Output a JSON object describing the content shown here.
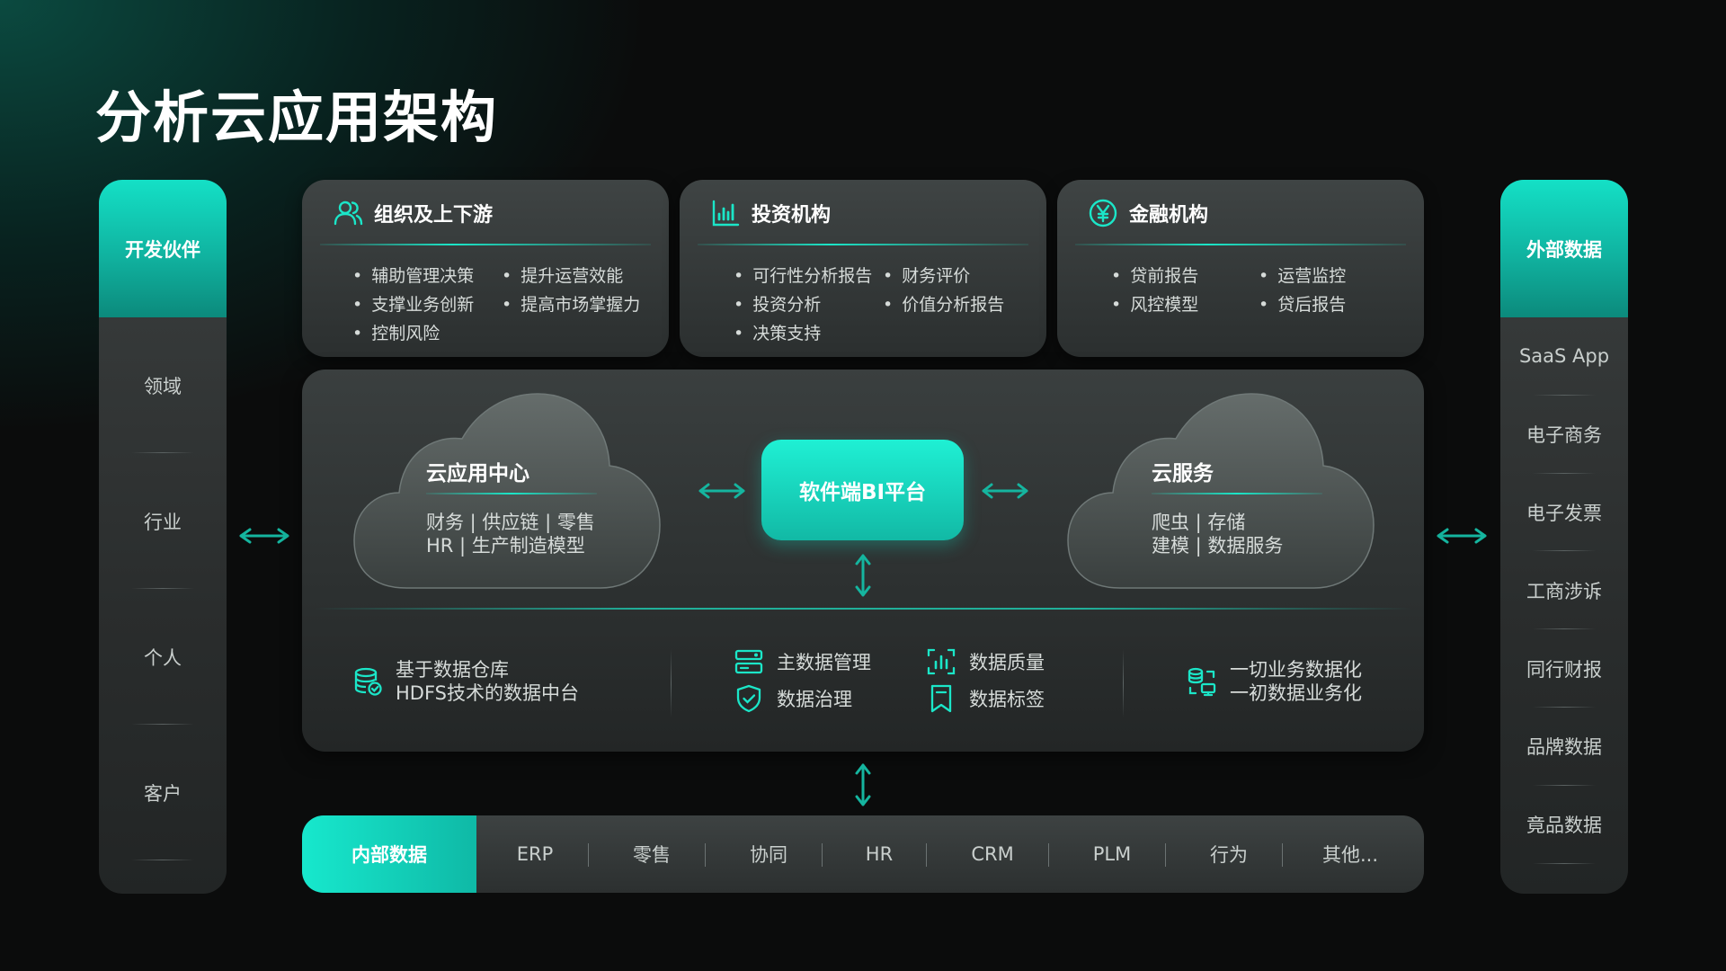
{
  "title": "分析云应用架构",
  "colors": {
    "accent": "#1be6c8",
    "accent_dark": "#0fb9a6",
    "background": "#0b0c0c"
  },
  "left_panel": {
    "header": "开发伙伴",
    "items": [
      "领域",
      "行业",
      "个人",
      "客户"
    ]
  },
  "right_panel": {
    "header": "外部数据",
    "items": [
      "SaaS App",
      "电子商务",
      "电子发票",
      "工商涉诉",
      "同行财报",
      "品牌数据",
      "竟品数据"
    ]
  },
  "cards": [
    {
      "icon": "users-icon",
      "title": "组织及上下游",
      "items": [
        "辅助管理决策",
        "提升运营效能",
        "支撑业务创新",
        "提高市场掌握力",
        "控制风险"
      ]
    },
    {
      "icon": "bar-chart-icon",
      "title": "投资机构",
      "items": [
        "可行性分析报告",
        "财务评价",
        "投资分析",
        "价值分析报告",
        "决策支持"
      ]
    },
    {
      "icon": "yen-icon",
      "title": "金融机构",
      "items": [
        "贷前报告",
        "运营监控",
        "风控模型",
        "贷后报告"
      ]
    }
  ],
  "middle": {
    "cloud_left": {
      "title": "云应用中心",
      "line1": "财务 | 供应链 | 零售",
      "line2": "HR | 生产制造模型"
    },
    "bi_platform": "软件端BI平台",
    "cloud_right": {
      "title": "云服务",
      "line1": "爬虫 | 存储",
      "line2": "建模 | 数据服务"
    },
    "features": {
      "warehouse": {
        "icon": "database-check-icon",
        "line1": "基于数据仓库",
        "line2": "HDFS技术的数据中台"
      },
      "master_data": {
        "icon": "master-data-icon",
        "label": "主数据管理"
      },
      "governance": {
        "icon": "shield-check-icon",
        "label": "数据治理"
      },
      "quality": {
        "icon": "quality-chart-icon",
        "label": "数据质量"
      },
      "tags": {
        "icon": "bookmark-icon",
        "label": "数据标签"
      },
      "digitalize": {
        "icon": "data-flow-icon",
        "line1": "一切业务数据化",
        "line2": "一初数据业务化"
      }
    }
  },
  "bottom_bar": {
    "header": "内部数据",
    "items": [
      "ERP",
      "零售",
      "协同",
      "HR",
      "CRM",
      "PLM",
      "行为",
      "其他..."
    ]
  }
}
